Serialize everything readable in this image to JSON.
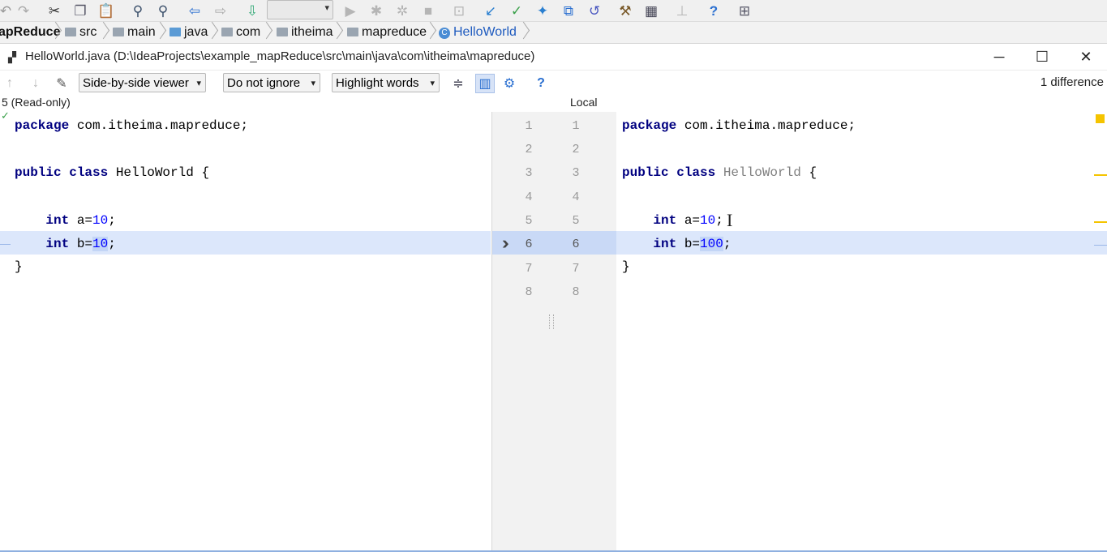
{
  "breadcrumb": {
    "items": [
      "apReduce",
      "src",
      "main",
      "java",
      "com",
      "itheima",
      "mapreduce",
      "HelloWorld"
    ]
  },
  "window": {
    "title": "HelloWorld.java (D:\\IdeaProjects\\example_mapReduce\\src\\main\\java\\com\\itheima\\mapreduce)"
  },
  "diff_toolbar": {
    "viewer": "Side-by-side viewer",
    "ignore": "Do not ignore",
    "highlight": "Highlight words",
    "difference_count": "1 difference"
  },
  "left_panel": {
    "title": "5 (Read-only)",
    "lines": [
      {
        "kw": "package",
        "text": " com.itheima.mapreduce;"
      },
      {
        "kw": "",
        "text": ""
      },
      {
        "kw": "public class",
        "text": " HelloWorld {"
      },
      {
        "kw": "",
        "text": ""
      },
      {
        "kw": "int",
        "pre": "    ",
        "text": " a=",
        "num": "10",
        "post": ";"
      },
      {
        "kw": "int",
        "pre": "    ",
        "text": " b=",
        "num": "10",
        "post": ";"
      },
      {
        "kw": "",
        "text": "}"
      },
      {
        "kw": "",
        "text": ""
      }
    ]
  },
  "right_panel": {
    "title": "Local",
    "lines": [
      {
        "kw": "package",
        "text": " com.itheima.mapreduce;"
      },
      {
        "kw": "",
        "text": ""
      },
      {
        "kw": "public class",
        "text": " HelloWorld",
        "post": " {"
      },
      {
        "kw": "",
        "text": ""
      },
      {
        "kw": "int",
        "pre": "    ",
        "text": " a=",
        "num": "10",
        "post": ";"
      },
      {
        "kw": "int",
        "pre": "    ",
        "text": " b=",
        "num": "100",
        "post": ";"
      },
      {
        "kw": "",
        "text": "}"
      },
      {
        "kw": "",
        "text": ""
      }
    ]
  },
  "gutter": {
    "left_numbers": [
      "1",
      "2",
      "3",
      "4",
      "5",
      "6",
      "7",
      "8"
    ],
    "right_numbers": [
      "1",
      "2",
      "3",
      "4",
      "5",
      "6",
      "7",
      "8"
    ],
    "apply_icon": "double-chevron-right-icon"
  },
  "colors": {
    "changed_line": "#dce7fb",
    "keyword": "#000080",
    "number": "#0000ff",
    "marker": "#f5c400"
  }
}
